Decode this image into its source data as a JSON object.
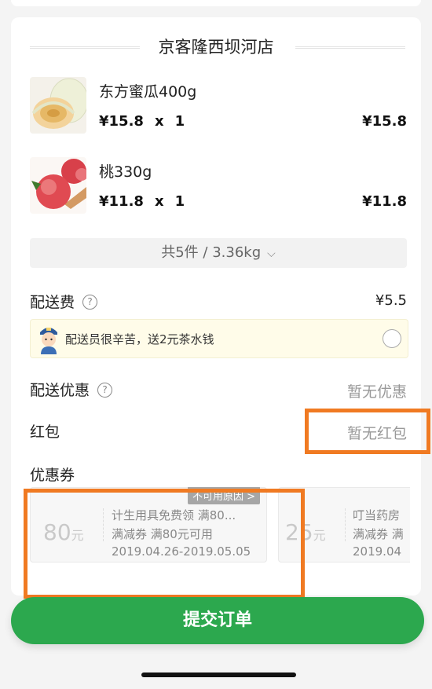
{
  "store": {
    "name": "京客隆西坝河店"
  },
  "items": [
    {
      "name": "东方蜜瓜400g",
      "price": "¥15.8",
      "x": "x",
      "qty": "1",
      "subtotal": "¥15.8",
      "image": "melon-image"
    },
    {
      "name": "桃330g",
      "price": "¥11.8",
      "x": "x",
      "qty": "1",
      "subtotal": "¥11.8",
      "image": "peach-image"
    }
  ],
  "summary": {
    "text": "共5件 / 3.36kg",
    "chevron": "⌵"
  },
  "delivery_fee": {
    "label": "配送费",
    "help": "?",
    "value": "¥5.5"
  },
  "tip": {
    "text": "配送员很辛苦，送2元茶水钱",
    "icon": "courier-avatar-icon"
  },
  "delivery_discount": {
    "label": "配送优惠",
    "help": "?",
    "value": "暂无优惠"
  },
  "red_packet": {
    "label": "红包",
    "value": "暂无红包"
  },
  "coupons_section": {
    "label": "优惠券",
    "coupons": [
      {
        "amount": "80",
        "unit": "元",
        "title": "计生用具免费领 满80...",
        "type": "满减券 满80元可用",
        "date": "2019.04.26-2019.05.05",
        "reason": "不可用原因 >"
      },
      {
        "amount": "25",
        "unit": "元",
        "title": "叮当药房",
        "type": "满减券 满",
        "date": "2019.04",
        "reason": ""
      }
    ]
  },
  "submit": {
    "label": "提交订单"
  },
  "colors": {
    "accent_green": "#2ca84e",
    "highlight_orange": "#f07a22"
  }
}
